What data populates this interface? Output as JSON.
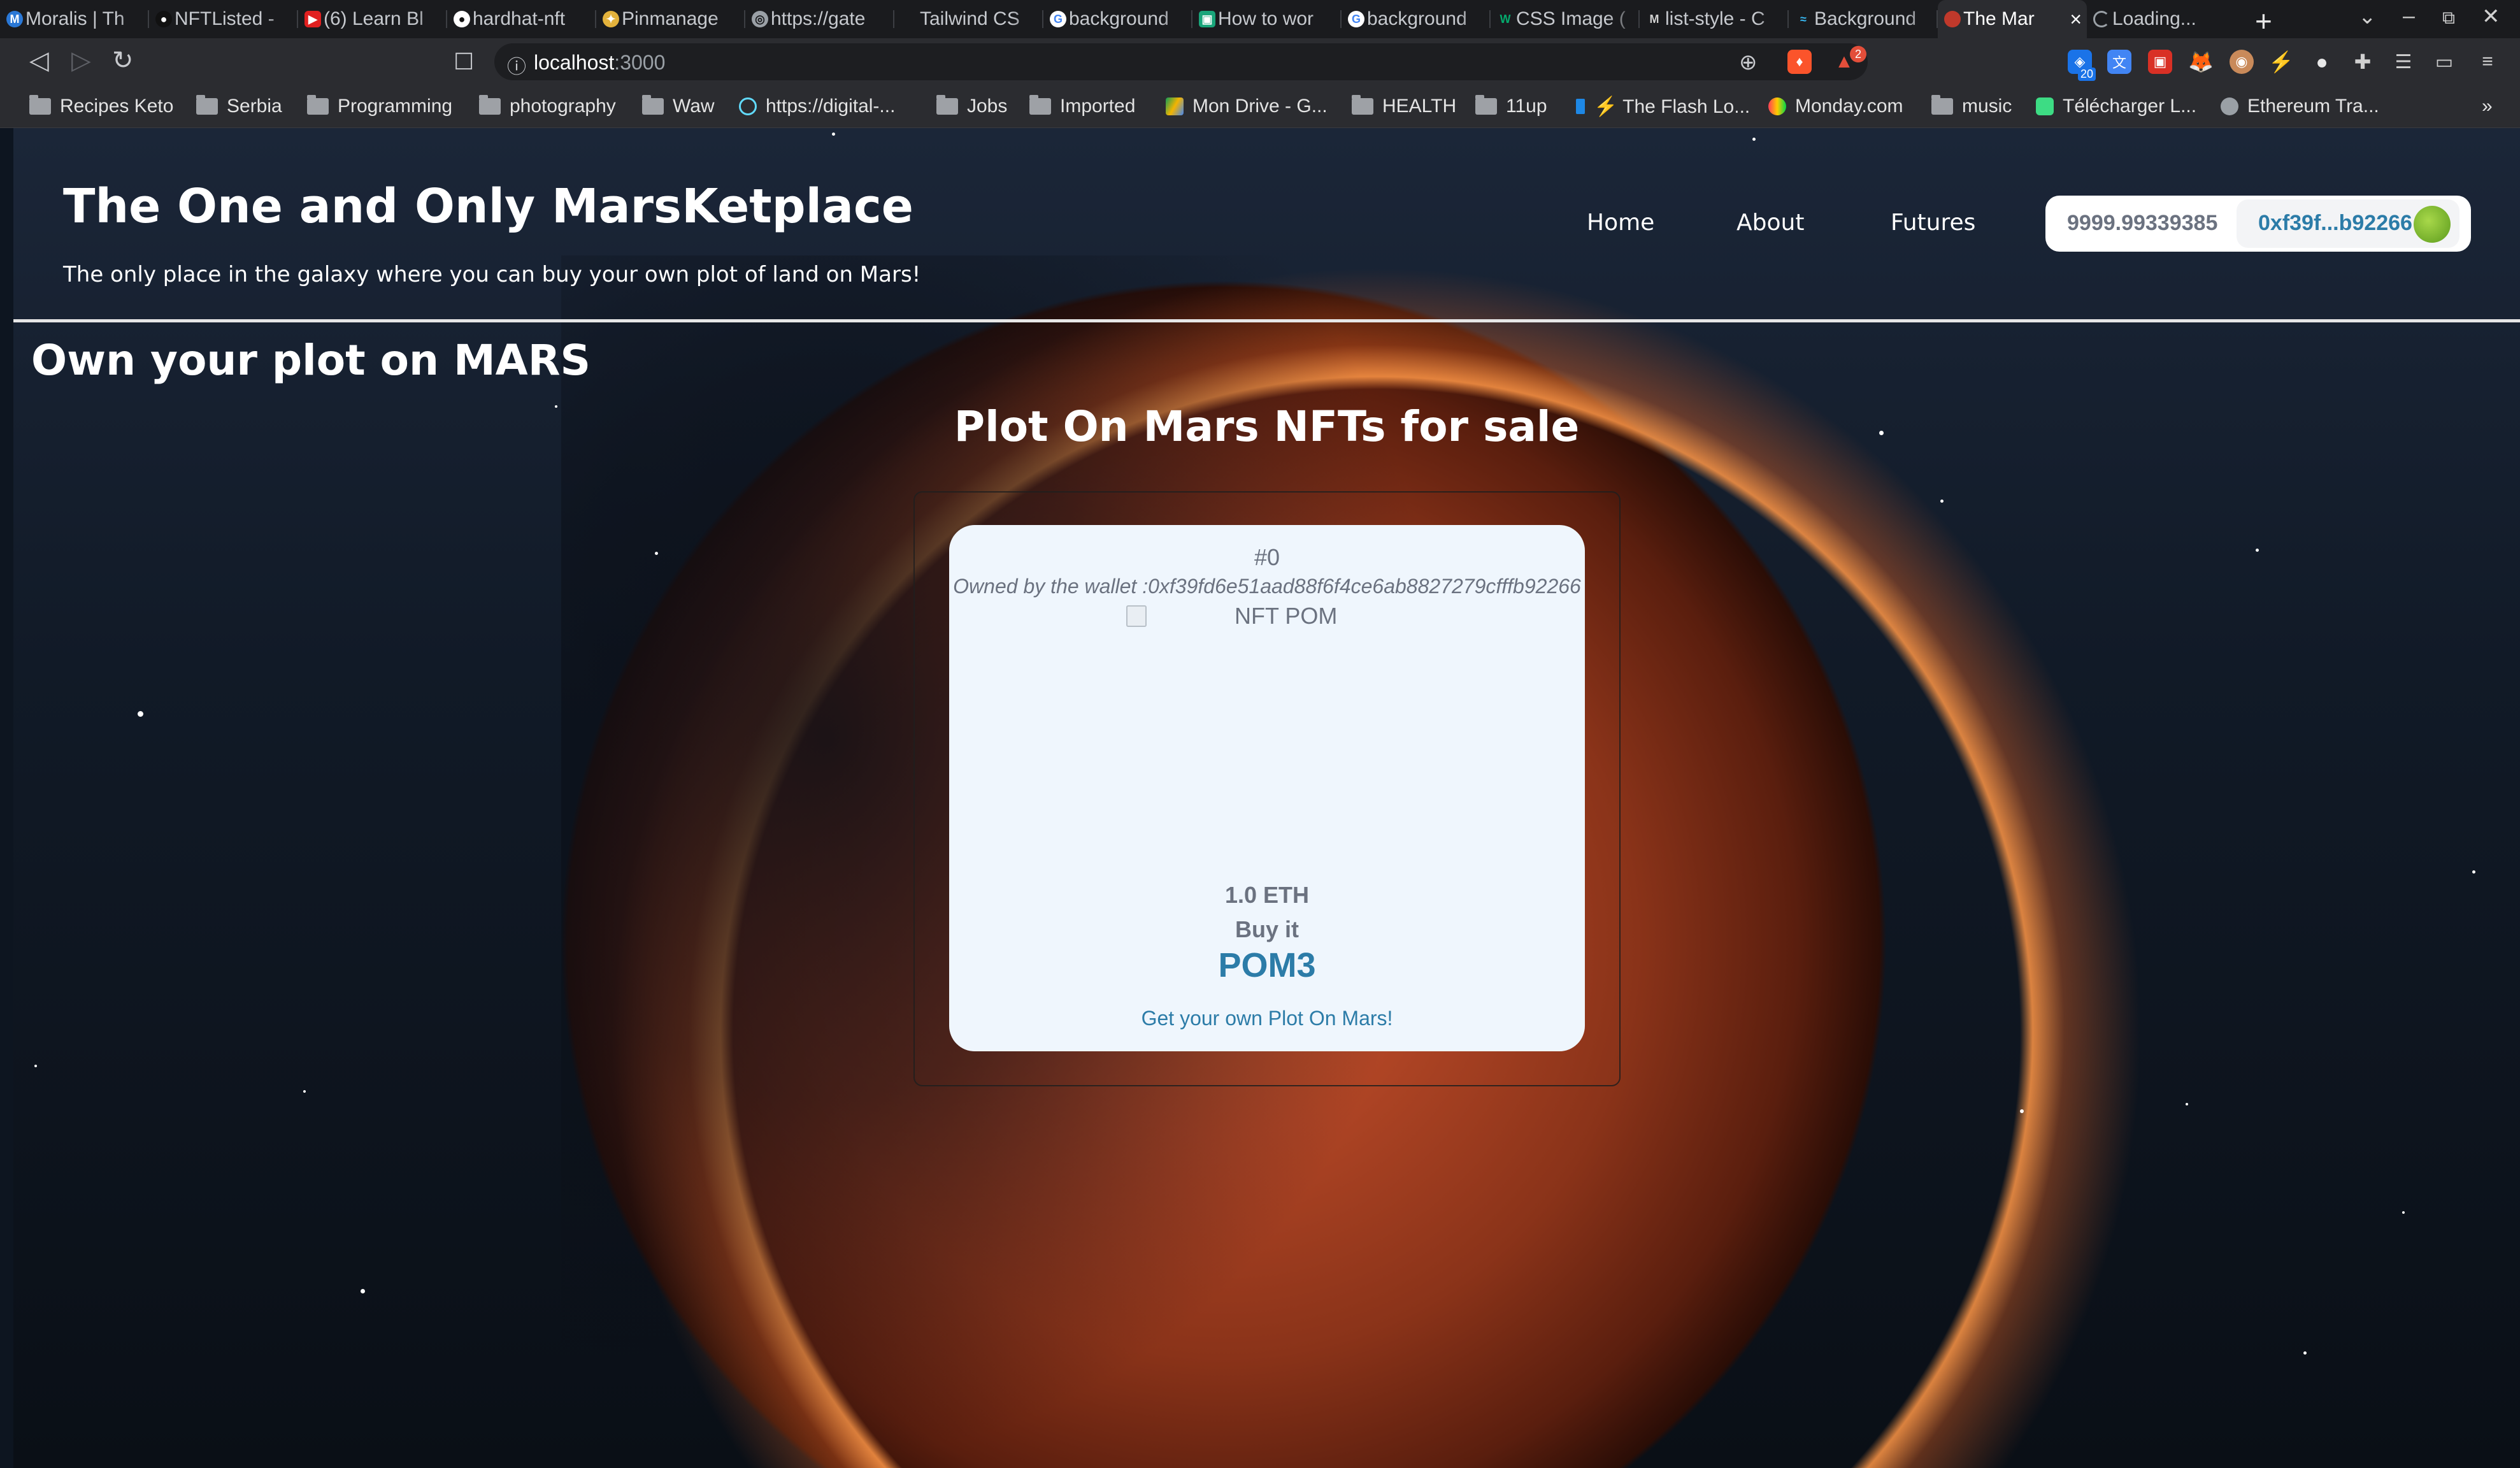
{
  "browser": {
    "tabs": [
      {
        "title": "Moralis | Th",
        "icon": "moralis-icon",
        "color": "#2a78d6"
      },
      {
        "title": "NFTListed -",
        "icon": "medium-icon",
        "color": "#111111"
      },
      {
        "title": "(6) Learn Bl",
        "icon": "youtube-icon",
        "color": "#e02020"
      },
      {
        "title": "hardhat-nft",
        "icon": "github-icon",
        "color": "#ffffff"
      },
      {
        "title": "Pinmanage",
        "icon": "pinata-icon",
        "color": "#e3b23c"
      },
      {
        "title": "https://gate",
        "icon": "globe-icon",
        "color": "#9aa0a6"
      },
      {
        "title": "Tailwind CS",
        "icon": "blank-icon",
        "color": "#1a1b1e"
      },
      {
        "title": "background",
        "icon": "google-icon",
        "color": "#ffffff"
      },
      {
        "title": "How to wor",
        "icon": "web-icon",
        "color": "#19a57a"
      },
      {
        "title": "background",
        "icon": "google-icon",
        "color": "#ffffff"
      },
      {
        "title": "CSS Image (",
        "icon": "w3-icon",
        "color": "#04aa6d"
      },
      {
        "title": "list-style - C",
        "icon": "mdn-icon",
        "color": "#d0d0d0"
      },
      {
        "title": "Background",
        "icon": "tailwind-icon",
        "color": "#38bdf8"
      },
      {
        "title": "The Mar",
        "icon": "mars-icon",
        "color": "#c0392b"
      },
      {
        "title": "Loading...",
        "icon": "spinner-icon",
        "color": "#9aa0a6"
      }
    ],
    "url_host": "localhost",
    "url_port": ":3000",
    "brave_badge": "2",
    "ext_badge": "20",
    "bookmarks": [
      {
        "label": "Recipes Keto",
        "type": "folder"
      },
      {
        "label": "Serbia",
        "type": "folder"
      },
      {
        "label": "Programming",
        "type": "folder"
      },
      {
        "label": "photography",
        "type": "folder"
      },
      {
        "label": "Waw",
        "type": "folder"
      },
      {
        "label": "https://digital-...",
        "type": "link",
        "color": "#61dafb"
      },
      {
        "label": "Jobs",
        "type": "folder"
      },
      {
        "label": "Imported",
        "type": "folder"
      },
      {
        "label": "Mon Drive - G...",
        "type": "link",
        "color": "#f4b400"
      },
      {
        "label": "HEALTH",
        "type": "folder"
      },
      {
        "label": "11up",
        "type": "folder"
      },
      {
        "label": "⚡ The Flash Lo...",
        "type": "link",
        "color": "#1e88e5"
      },
      {
        "label": "Monday.com",
        "type": "link",
        "color": "#ff3d57"
      },
      {
        "label": "music",
        "type": "folder"
      },
      {
        "label": "Télécharger L...",
        "type": "link",
        "color": "#3ddc84"
      },
      {
        "label": "Ethereum Tra...",
        "type": "link",
        "color": "#9aa0a6"
      }
    ]
  },
  "site": {
    "title": "The One and Only MarsKetplace",
    "subtitle": "The only place in the galaxy where you can buy your own plot of land on Mars!",
    "nav": [
      "Home",
      "About",
      "Futures"
    ],
    "wallet_balance": "9999.99339385",
    "wallet_address": "0xf39f...b92266"
  },
  "main": {
    "heading": "Own your plot on MARS",
    "section_title": "Plot On Mars NFTs for sale",
    "card": {
      "id": "#0",
      "owner": "Owned by the wallet :0xf39fd6e51aad88f6f4ce6ab8827279cfffb92266",
      "image_alt": "NFT POM",
      "price": "1.0 ETH",
      "buy": "Buy it",
      "name": "POM3",
      "link": "Get your own Plot On Mars!"
    }
  }
}
